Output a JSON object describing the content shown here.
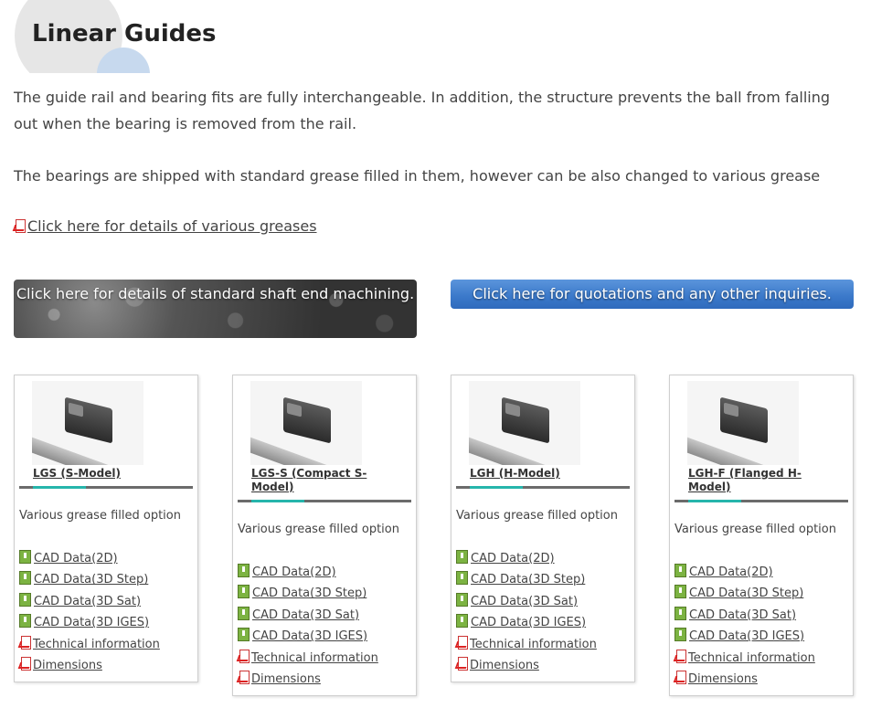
{
  "page": {
    "title": "Linear Guides"
  },
  "intro": {
    "paragraph1": "The guide rail and bearing fits are fully interchangeable. In addition, the structure prevents the ball from falling out when the bearing is removed from the rail.",
    "paragraph2": "The bearings are shipped with standard grease filled in them, however can be also changed to various grease",
    "grease_link": "Click here for details of various greases"
  },
  "banners": {
    "shaft_end": "Click here for details of standard shaft end machining.",
    "quotation": "Click here for quotations and any other inquiries."
  },
  "products": [
    {
      "name": "LGS (S-Model)",
      "description": "Various grease filled option",
      "links": [
        "CAD Data(2D)",
        "CAD Data(3D Step)",
        "CAD Data(3D Sat)",
        "CAD Data(3D IGES)",
        "Technical information",
        "Dimensions"
      ]
    },
    {
      "name": "LGS-S (Compact S-Model)",
      "description": "Various grease filled option",
      "links": [
        "CAD Data(2D)",
        "CAD Data(3D Step)",
        "CAD Data(3D Sat)",
        "CAD Data(3D IGES)",
        "Technical information",
        "Dimensions"
      ]
    },
    {
      "name": "LGH (H-Model)",
      "description": "Various grease filled option",
      "links": [
        "CAD Data(2D)",
        "CAD Data(3D Step)",
        "CAD Data(3D Sat)",
        "CAD Data(3D IGES)",
        "Technical information",
        "Dimensions"
      ]
    },
    {
      "name": "LGH-F (Flanged H-Model)",
      "description": "Various grease filled option",
      "links": [
        "CAD Data(2D)",
        "CAD Data(3D Step)",
        "CAD Data(3D Sat)",
        "CAD Data(3D IGES)",
        "Technical information",
        "Dimensions"
      ]
    }
  ],
  "colors": {
    "accent_teal": "#26b5ab",
    "banner_blue": "#3a78c9",
    "banner_dark": "#444444",
    "cad_icon_green": "#7cb342",
    "pdf_icon_red": "#cc2222"
  }
}
